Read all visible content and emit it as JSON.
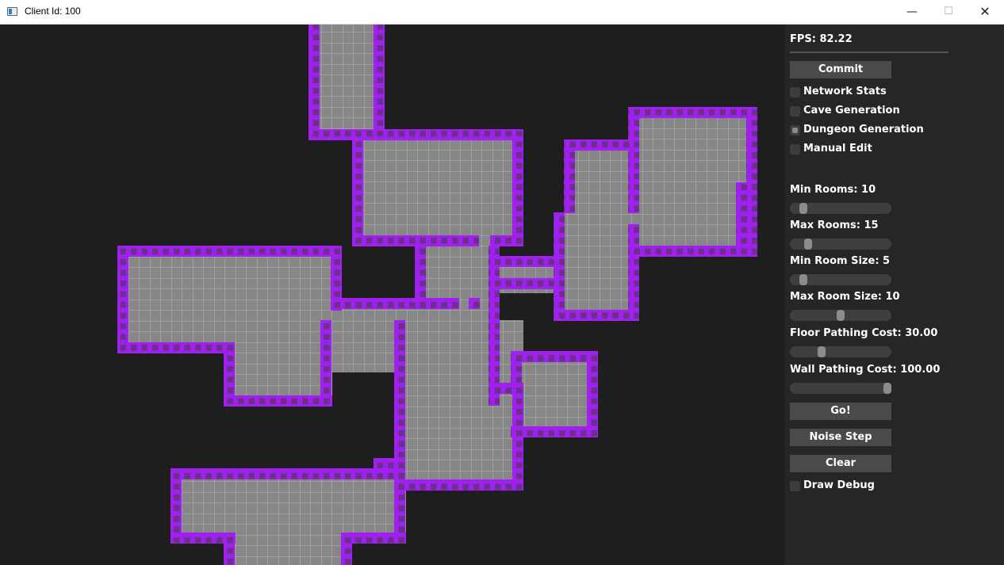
{
  "window": {
    "title": "Client Id: 100",
    "minimize_icon": "minimize-icon",
    "maximize_icon": "maximize-icon",
    "close_icon": "close-icon"
  },
  "map": {
    "colors": {
      "background": "#1e1e1e",
      "floor": "#878787",
      "grid": "#b4b4b4",
      "wall": "#a020f0",
      "wall_inner": "#6c2f8a"
    },
    "floor_rects": [
      [
        389,
        31,
        96,
        146
      ],
      [
        444,
        163,
        216,
        148
      ],
      [
        148,
        310,
        283,
        135
      ],
      [
        283,
        432,
        136,
        81
      ],
      [
        404,
        376,
        133,
        94
      ],
      [
        523,
        297,
        96,
        305
      ],
      [
        497,
        404,
        163,
        201
      ],
      [
        616,
        323,
        95,
        47
      ],
      [
        215,
        591,
        297,
        95
      ],
      [
        282,
        672,
        162,
        41
      ],
      [
        698,
        268,
        108,
        137
      ],
      [
        711,
        176,
        94,
        93
      ],
      [
        792,
        135,
        163,
        189
      ],
      [
        644,
        443,
        110,
        109
      ],
      [
        616,
        483,
        44,
        27
      ]
    ],
    "wall_rects": [
      [
        389,
        31,
        14,
        146
      ],
      [
        471,
        31,
        14,
        132
      ],
      [
        389,
        163,
        56,
        14
      ],
      [
        444,
        163,
        14,
        148
      ],
      [
        444,
        163,
        216,
        14
      ],
      [
        646,
        163,
        14,
        148
      ],
      [
        444,
        297,
        106,
        14
      ],
      [
        550,
        297,
        54,
        14
      ],
      [
        618,
        297,
        42,
        14
      ],
      [
        148,
        310,
        283,
        14
      ],
      [
        148,
        310,
        14,
        135
      ],
      [
        148,
        432,
        148,
        14
      ],
      [
        282,
        432,
        14,
        81
      ],
      [
        282,
        499,
        137,
        14
      ],
      [
        417,
        310,
        14,
        82
      ],
      [
        404,
        404,
        14,
        109
      ],
      [
        417,
        376,
        120,
        14
      ],
      [
        537,
        376,
        42,
        14
      ],
      [
        591,
        376,
        14,
        14
      ],
      [
        497,
        404,
        14,
        40
      ],
      [
        523,
        310,
        14,
        66
      ],
      [
        616,
        310,
        14,
        202
      ],
      [
        630,
        323,
        81,
        14
      ],
      [
        630,
        351,
        68,
        14
      ],
      [
        497,
        443,
        14,
        162
      ],
      [
        471,
        578,
        40,
        14
      ],
      [
        215,
        591,
        296,
        14
      ],
      [
        215,
        591,
        14,
        95
      ],
      [
        215,
        672,
        82,
        14
      ],
      [
        282,
        672,
        14,
        41
      ],
      [
        430,
        672,
        14,
        41
      ],
      [
        430,
        672,
        82,
        14
      ],
      [
        497,
        605,
        14,
        81
      ],
      [
        511,
        605,
        149,
        14
      ],
      [
        646,
        497,
        14,
        122
      ],
      [
        644,
        443,
        110,
        14
      ],
      [
        644,
        443,
        14,
        55
      ],
      [
        740,
        443,
        14,
        109
      ],
      [
        644,
        538,
        110,
        14
      ],
      [
        616,
        483,
        44,
        14
      ],
      [
        698,
        268,
        14,
        137
      ],
      [
        698,
        391,
        108,
        14
      ],
      [
        711,
        176,
        94,
        14
      ],
      [
        711,
        176,
        14,
        93
      ],
      [
        792,
        283,
        14,
        122
      ],
      [
        792,
        135,
        163,
        14
      ],
      [
        792,
        135,
        14,
        134
      ],
      [
        941,
        135,
        14,
        189
      ],
      [
        806,
        310,
        149,
        14
      ],
      [
        928,
        230,
        14,
        94
      ]
    ],
    "inner_walls": [
      [
        497,
        404,
        14,
        40
      ],
      [
        550,
        378,
        27,
        12
      ]
    ]
  },
  "panel": {
    "fps": "FPS: 82.22",
    "commit": "Commit",
    "checkboxes": [
      {
        "label": "Network Stats",
        "checked": false
      },
      {
        "label": "Cave Generation",
        "checked": false
      },
      {
        "label": "Dungeon Generation",
        "checked": true
      },
      {
        "label": "Manual Edit",
        "checked": false
      }
    ],
    "sliders": [
      {
        "label": "Min Rooms: 10",
        "value": 10,
        "min": 0,
        "max": 100
      },
      {
        "label": "Max Rooms: 15",
        "value": 15,
        "min": 0,
        "max": 100
      },
      {
        "label": "Min Room Size: 5",
        "value": 5,
        "min": 0,
        "max": 50
      },
      {
        "label": "Max Room Size: 10",
        "value": 10,
        "min": 0,
        "max": 20
      },
      {
        "label": "Floor Pathing Cost: 30.00",
        "value": 30,
        "min": 0,
        "max": 100
      },
      {
        "label": "Wall Pathing Cost: 100.00",
        "value": 100,
        "min": 0,
        "max": 100
      }
    ],
    "go": "Go!",
    "noise_step": "Noise Step",
    "clear": "Clear",
    "draw_debug": {
      "label": "Draw Debug",
      "checked": false
    }
  }
}
